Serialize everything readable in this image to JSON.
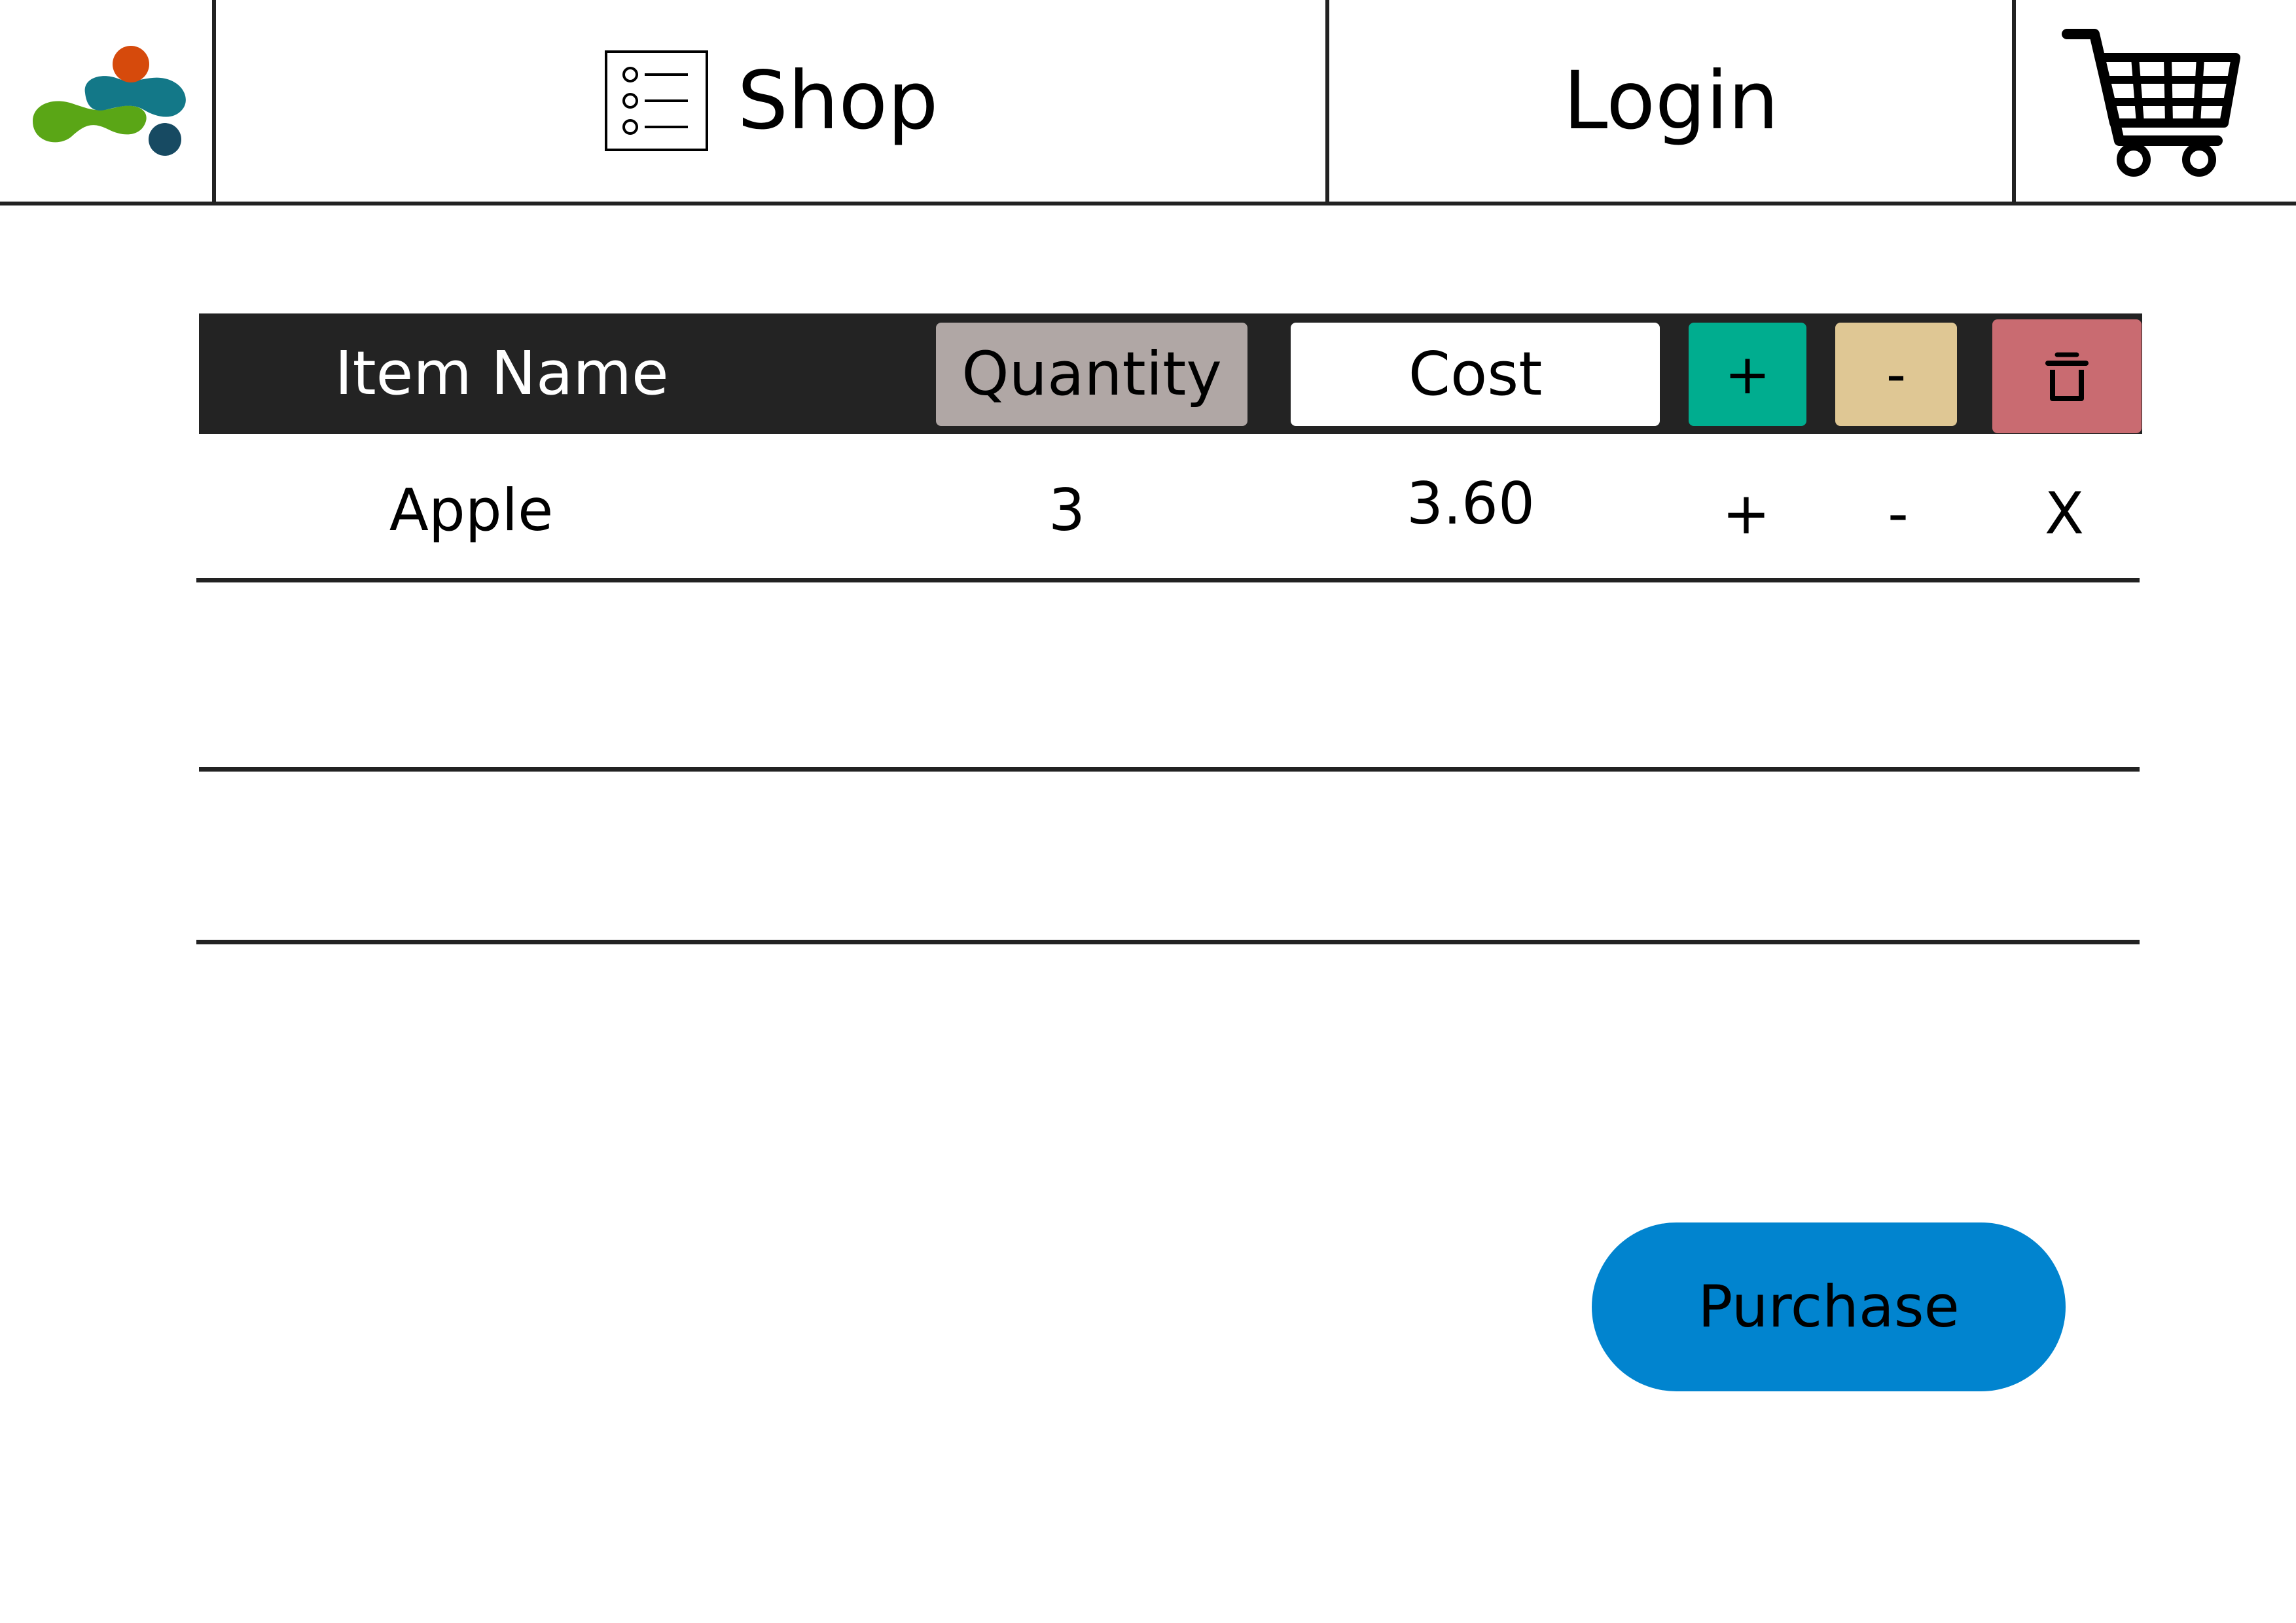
{
  "nav": {
    "shop_label": "Shop",
    "login_label": "Login"
  },
  "icons": {
    "logo": "logo-blobs",
    "shop": "list-icon",
    "cart": "shopping-cart-icon",
    "delete": "trash-icon"
  },
  "colors": {
    "header_bg": "#232323",
    "quantity_header_bg": "#b0a7a5",
    "cost_header_bg": "#ffffff",
    "plus_header_bg": "#00ad8f",
    "minus_header_bg": "#dfc794",
    "delete_header_bg": "#c96b71",
    "purchase_bg": "#0184cf",
    "logo_orange": "#d64a0c",
    "logo_teal": "#137888",
    "logo_green": "#5aa616",
    "logo_navy": "#174a62"
  },
  "table": {
    "headers": {
      "item_name": "Item Name",
      "quantity": "Quantity",
      "cost": "Cost",
      "plus": "+",
      "minus": "-"
    },
    "rows": [
      {
        "name": "Apple",
        "quantity": "3",
        "cost": "3.60",
        "plus": "+",
        "minus": "-",
        "remove": "X"
      }
    ]
  },
  "purchase_label": "Purchase"
}
